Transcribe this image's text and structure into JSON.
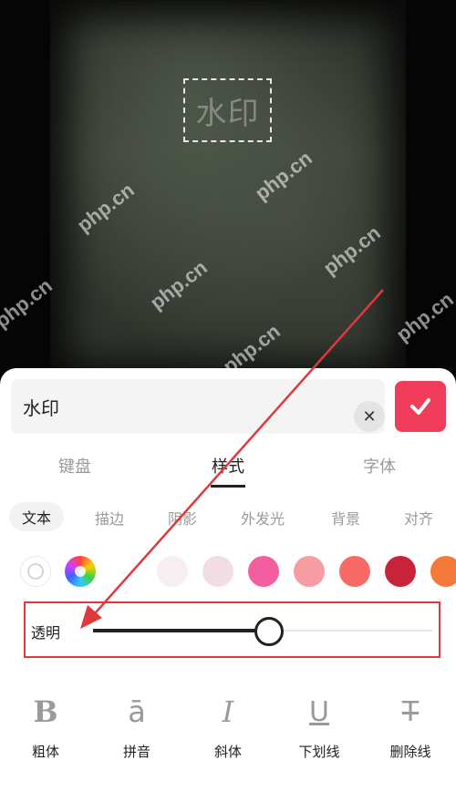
{
  "preview": {
    "watermark_text": "水印",
    "site_watermark": "php.cn"
  },
  "editor": {
    "input_value": "水印",
    "clear_icon": "close-icon",
    "confirm_icon": "check-icon"
  },
  "tabs": [
    {
      "label": "键盘",
      "active": false
    },
    {
      "label": "样式",
      "active": true
    },
    {
      "label": "字体",
      "active": false
    }
  ],
  "subtabs": [
    {
      "label": "文本",
      "active": true
    },
    {
      "label": "描边",
      "active": false
    },
    {
      "label": "阴影",
      "active": false
    },
    {
      "label": "外发光",
      "active": false
    },
    {
      "label": "背景",
      "active": false
    },
    {
      "label": "对齐",
      "active": false
    }
  ],
  "colors": {
    "swatches": [
      "#f6eef0",
      "#f3dde4",
      "#f25fa0",
      "#f79ca2",
      "#f76a66",
      "#c9233a",
      "#f47a3a"
    ],
    "accent": "#f03d5a",
    "highlight": "#e0383b"
  },
  "opacity": {
    "label": "透明",
    "value": 0.52
  },
  "tools": [
    {
      "icon": "bold-icon",
      "glyph": "B",
      "label": "粗体"
    },
    {
      "icon": "pinyin-icon",
      "glyph": "ā",
      "label": "拼音"
    },
    {
      "icon": "italic-icon",
      "glyph": "I",
      "label": "斜体"
    },
    {
      "icon": "underline-icon",
      "glyph": "U",
      "label": "下划线"
    },
    {
      "icon": "strikethrough-icon",
      "glyph": "T",
      "label": "删除线"
    }
  ]
}
